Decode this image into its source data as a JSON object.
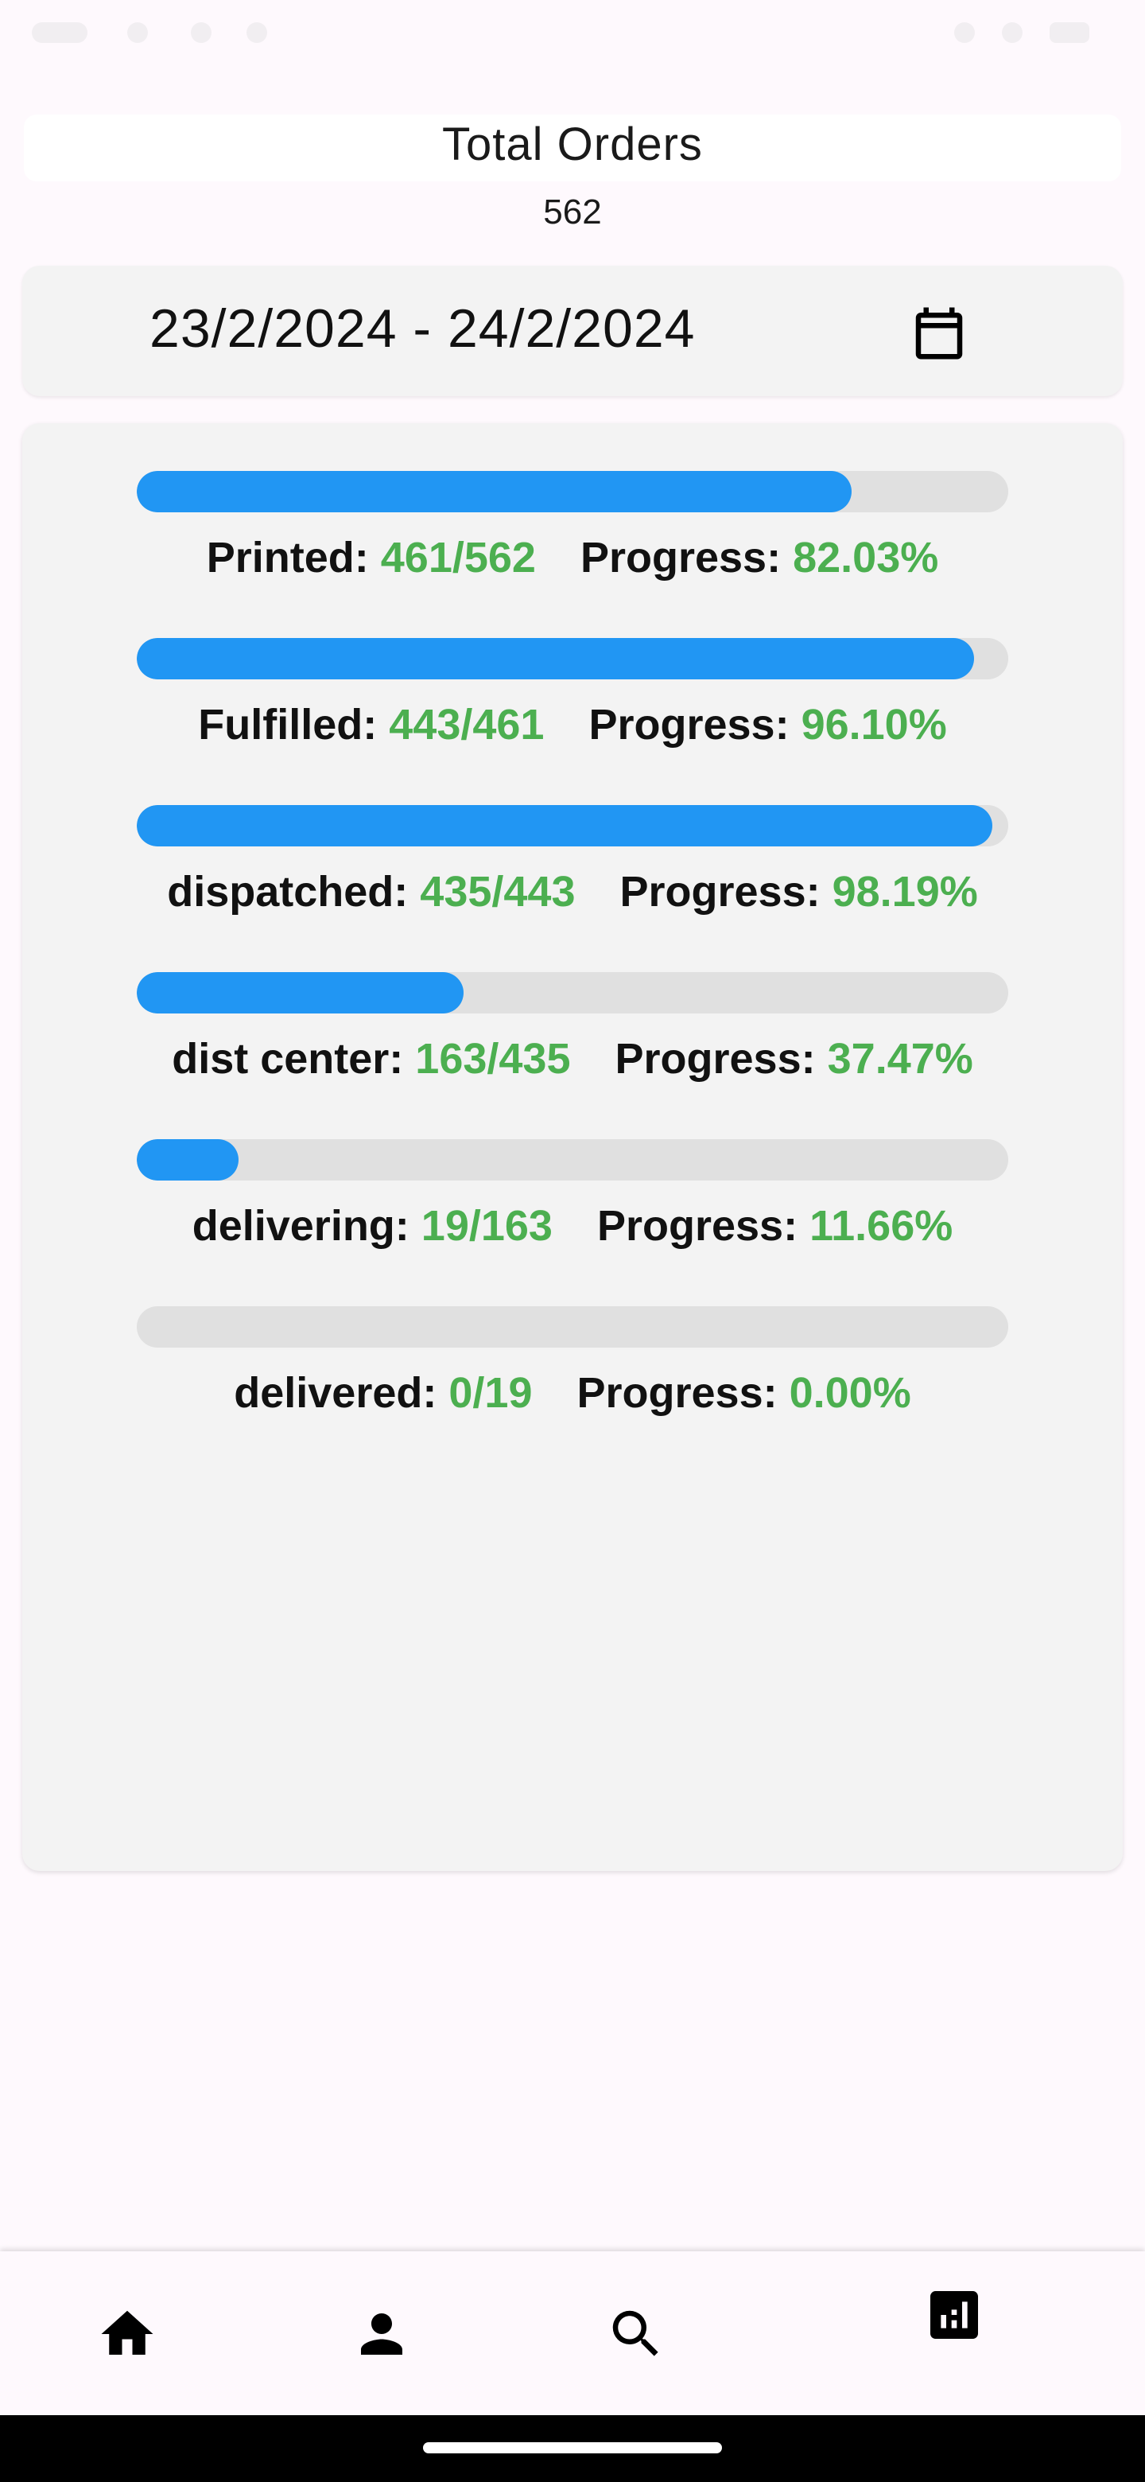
{
  "summary": {
    "title": "Total Orders",
    "total": "562"
  },
  "date_range": {
    "text": "23/2/2024 - 24/2/2024",
    "icon": "calendar-icon"
  },
  "stages": [
    {
      "label": "Printed:",
      "count": "461/562",
      "progress_label": "Progress:",
      "progress": "82.03%",
      "fraction": 0.8203
    },
    {
      "label": "Fulfilled:",
      "count": "443/461",
      "progress_label": "Progress:",
      "progress": "96.10%",
      "fraction": 0.961
    },
    {
      "label": "dispatched:",
      "count": "435/443",
      "progress_label": "Progress:",
      "progress": "98.19%",
      "fraction": 0.9819
    },
    {
      "label": "dist center:",
      "count": "163/435",
      "progress_label": "Progress:",
      "progress": "37.47%",
      "fraction": 0.3747
    },
    {
      "label": "delivering:",
      "count": "19/163",
      "progress_label": "Progress:",
      "progress": "11.66%",
      "fraction": 0.1166
    },
    {
      "label": "delivered:",
      "count": "0/19",
      "progress_label": "Progress:",
      "progress": "0.00%",
      "fraction": 0.0
    }
  ],
  "nav": {
    "items": [
      {
        "icon": "home-icon"
      },
      {
        "icon": "person-icon"
      },
      {
        "icon": "search-icon"
      },
      {
        "icon": "bar-chart-icon",
        "selected": true
      }
    ]
  },
  "colors": {
    "accent": "#2196F3",
    "track": "#E0E0E0",
    "value_green": "#4CAF50",
    "card_bg": "#F3F3F3",
    "page_bg": "#FEF9FD"
  }
}
